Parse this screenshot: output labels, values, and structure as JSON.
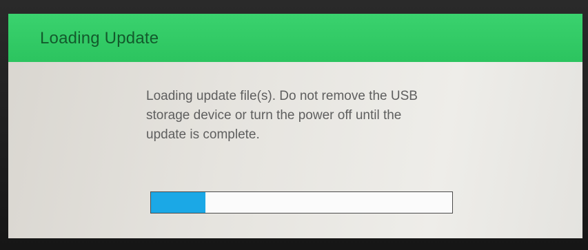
{
  "dialog": {
    "title": "Loading Update",
    "message_lines": [
      "Loading update file(s). Do not remove the USB",
      "storage device or turn the power off until the",
      "update is complete."
    ],
    "progress_fraction": 0.18
  },
  "colors": {
    "title_bar": "#33cc66",
    "progress_fill": "#1ba8e6",
    "dialog_background": "#e6e4df"
  }
}
